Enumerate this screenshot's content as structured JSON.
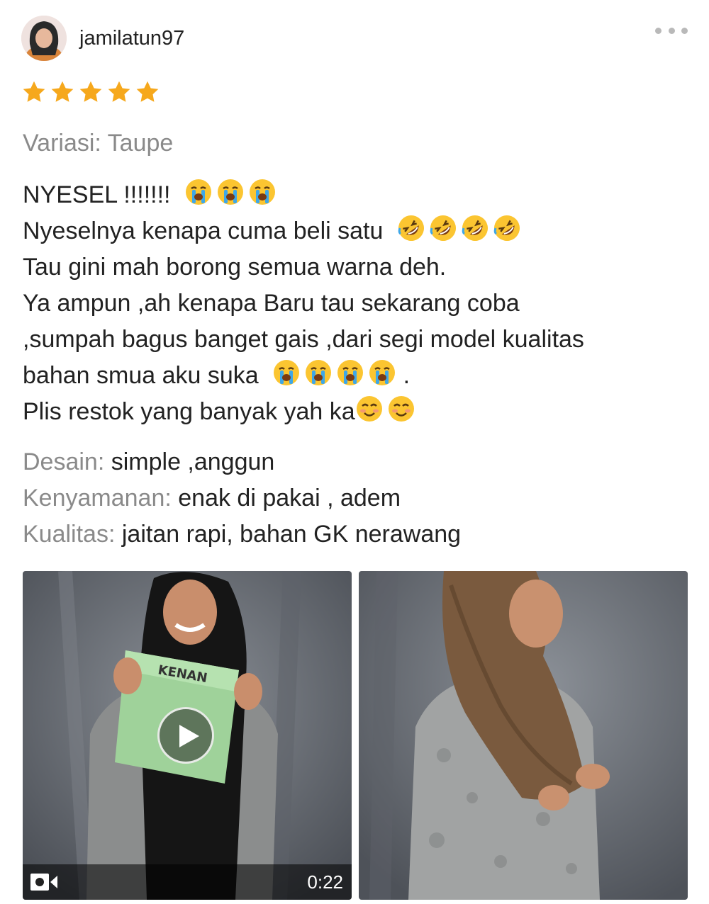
{
  "review": {
    "username": "jamilatun97",
    "rating": 5,
    "rating_max": 5,
    "variation": "Variasi: Taupe",
    "lines": [
      "NYESEL !!!!!!!",
      "Nyeselnya kenapa cuma beli satu",
      "Tau gini mah borong semua warna deh.",
      "Ya ampun ,ah kenapa Baru tau sekarang coba",
      ",sumpah bagus banget gais ,dari segi model kualitas",
      "bahan  smua aku suka",
      ".",
      "Plis restok yang banyak yah ka"
    ],
    "emoji": {
      "crying": "loudly-crying-face-emoji",
      "rofl": "rolling-on-floor-laughing-emoji",
      "smile": "smiling-face-emoji"
    },
    "attributes": [
      {
        "label": "Desain:",
        "value": " simple ,anggun"
      },
      {
        "label": "Kenyamanan:",
        "value": " enak di pakai , adem"
      },
      {
        "label": "Kualitas:",
        "value": " jaitan rapi, bahan GK nerawang"
      }
    ]
  },
  "media": {
    "video": {
      "duration": "0:22",
      "package_text": "KENAN",
      "icon": "video-camera-icon"
    },
    "photo": {
      "icon": "photo-thumbnail"
    }
  },
  "colors": {
    "star": "#f6a81c",
    "muted_text": "#8a8a8a",
    "body_text": "#222222"
  }
}
